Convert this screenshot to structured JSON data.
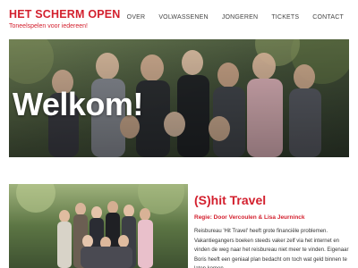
{
  "header": {
    "logo_title": "HET SCHERM OPEN",
    "logo_tagline": "Toneelspelen voor iedereen!",
    "nav": [
      {
        "label": "OVER"
      },
      {
        "label": "VOLWASSENEN"
      },
      {
        "label": "JONGEREN"
      },
      {
        "label": "TICKETS"
      },
      {
        "label": "CONTACT"
      }
    ]
  },
  "hero": {
    "title": "Welkom!"
  },
  "show": {
    "title": "(S)hit Travel",
    "credits": "Regie: Door Vercoulen & Lisa Jeurninck",
    "description": "Reisbureau 'Hit Travel' heeft grote financiële problemen. Vakantiegangers boeken steeds vaker zelf via het internet en vinden de weg naar het reisbureau niet meer te vinden. Eigenaar Boris heeft een geniaal plan bedacht om toch wat geld binnen te laten komen."
  },
  "colors": {
    "brand_red": "#d3202e",
    "nav_text": "#444444"
  }
}
